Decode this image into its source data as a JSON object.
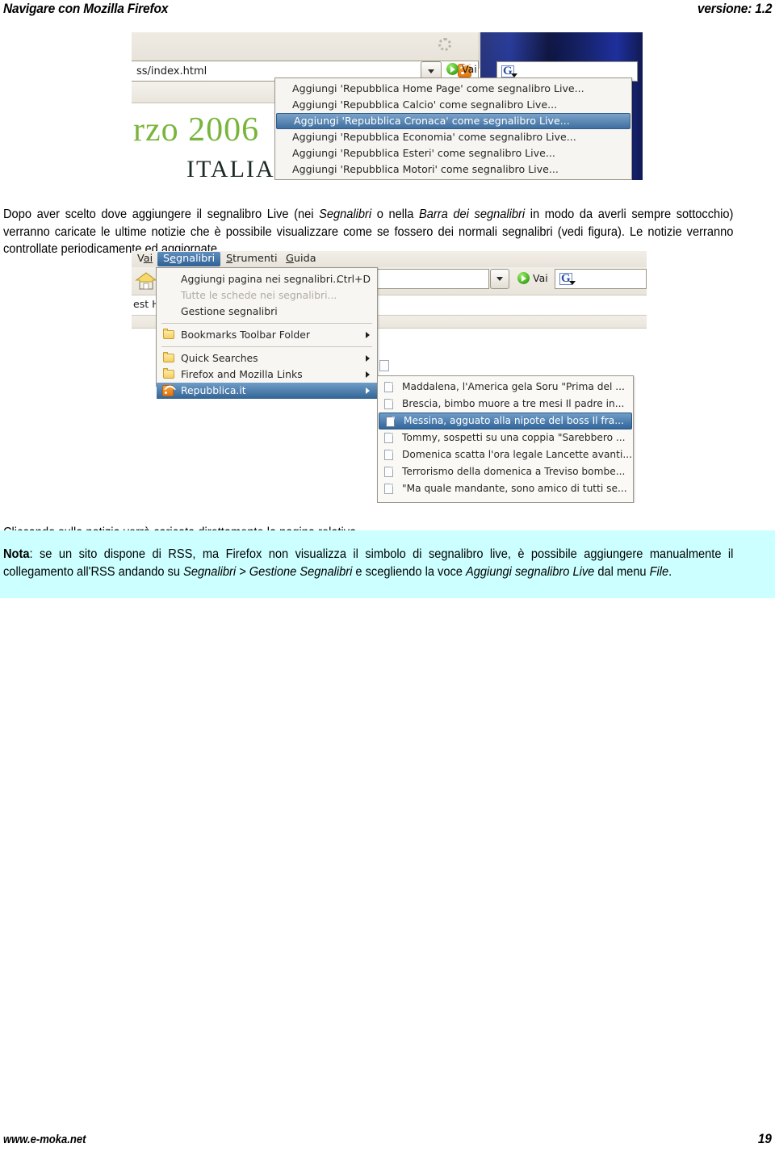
{
  "header": {
    "title": "Navigare con Mozilla Firefox",
    "version": "versione: 1.2"
  },
  "paragraphs": {
    "intro_part1": "Dopo aver scelto dove aggiungere il segnalibro Live (nei ",
    "intro_em1": "Segnalibri",
    "intro_part2": " o nella ",
    "intro_em2": "Barra dei segnalibri",
    "intro_part3": " in modo da averli sempre sottocchio) verranno caricate le ultime notizie che è possibile visualizzare come se fossero dei normali segnalibri (vedi figura). Le notizie verranno controllate periodicamente ed aggiornate.",
    "clicking": "Cliccando sulla notizia verrà caricata direttamente la pagina relativa."
  },
  "note": {
    "label": "Nota",
    "part1": ": se un sito dispone di RSS, ma Firefox non visualizza il simbolo di segnalibro live, è possibile aggiungere manualmente il collegamento all'RSS andando su ",
    "em1": "Segnalibri > Gestione Segnalibri",
    "part2": " e scegliendo la voce ",
    "em2": "Aggiungi segnalibro Live",
    "part3": " dal menu ",
    "em3": "File",
    "part4": "."
  },
  "screenshot1": {
    "url_text": "ss/index.html",
    "go_label": "Vai",
    "search_engine_icon": "G",
    "page_heading_green": "rzo 2006",
    "page_heading_serif": "ITALIANI",
    "live_menu": [
      {
        "label": "Aggiungi 'Repubblica Home Page' come segnalibro Live...",
        "selected": false
      },
      {
        "label": "Aggiungi 'Repubblica Calcio' come segnalibro Live...",
        "selected": false
      },
      {
        "label": "Aggiungi 'Repubblica Cronaca' come segnalibro Live...",
        "selected": true
      },
      {
        "label": "Aggiungi 'Repubblica Economia' come segnalibro Live...",
        "selected": false
      },
      {
        "label": "Aggiungi 'Repubblica Esteri' come segnalibro Live...",
        "selected": false
      },
      {
        "label": "Aggiungi 'Repubblica Motori' come segnalibro Live...",
        "selected": false
      }
    ]
  },
  "screenshot2": {
    "menubar": [
      {
        "label": "Vai",
        "active": false
      },
      {
        "label": "Segnalibri",
        "active": true
      },
      {
        "label": "Strumenti",
        "active": false
      },
      {
        "label": "Guida",
        "active": false
      }
    ],
    "go_label": "Vai",
    "search_engine_icon": "G",
    "bookmarks_bar_label": "est He",
    "bookmarks_menu": [
      {
        "label": "Aggiungi pagina nei segnalibri...",
        "shortcut": "Ctrl+D",
        "disabled": false,
        "icon": "none",
        "arrow": false,
        "highlighted": false
      },
      {
        "label": "Tutte le schede nei segnalibri...",
        "shortcut": "",
        "disabled": true,
        "icon": "none",
        "arrow": false,
        "highlighted": false
      },
      {
        "label": "Gestione segnalibri",
        "shortcut": "",
        "disabled": false,
        "icon": "none",
        "arrow": false,
        "highlighted": false
      },
      {
        "label": "Bookmarks Toolbar Folder",
        "shortcut": "",
        "disabled": false,
        "icon": "folder-icon",
        "arrow": true,
        "highlighted": false
      },
      {
        "label": "Quick Searches",
        "shortcut": "",
        "disabled": false,
        "icon": "folder-icon",
        "arrow": true,
        "highlighted": false
      },
      {
        "label": "Firefox and Mozilla Links",
        "shortcut": "",
        "disabled": false,
        "icon": "folder-icon",
        "arrow": true,
        "highlighted": false
      },
      {
        "label": "Repubblica.it",
        "shortcut": "",
        "disabled": false,
        "icon": "rss-icon",
        "arrow": true,
        "highlighted": true
      }
    ],
    "news_items": [
      {
        "label": "Maddalena, l'America gela Soru \"Prima del ...",
        "selected": false
      },
      {
        "label": "Brescia, bimbo muore a tre mesi Il padre in...",
        "selected": false
      },
      {
        "label": "Messina, agguato alla nipote del boss Il fra...",
        "selected": true
      },
      {
        "label": "Tommy, sospetti su una coppia \"Sarebbero ...",
        "selected": false
      },
      {
        "label": "Domenica scatta l'ora legale Lancette avanti...",
        "selected": false
      },
      {
        "label": "Terrorismo della domenica a Treviso bombe...",
        "selected": false
      },
      {
        "label": "\"Ma quale mandante, sono amico di tutti se...",
        "selected": false
      }
    ]
  },
  "footer": {
    "site": "www.e-moka.net",
    "page_number": "19"
  },
  "colors": {
    "note_highlight": "#ccffff",
    "menu_selection": "#336494",
    "rss_orange": "#e27610",
    "green_heading": "#79b53c"
  }
}
